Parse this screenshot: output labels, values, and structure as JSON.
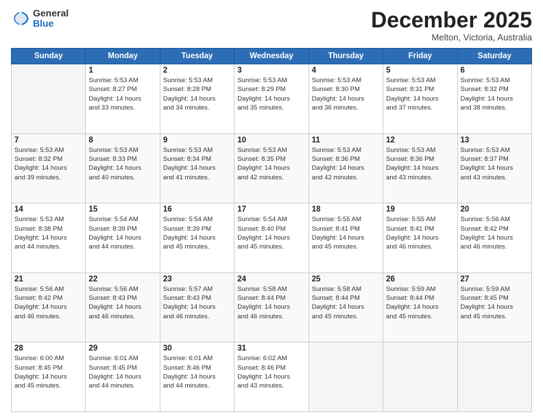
{
  "logo": {
    "general": "General",
    "blue": "Blue"
  },
  "header": {
    "month": "December 2025",
    "location": "Melton, Victoria, Australia"
  },
  "weekdays": [
    "Sunday",
    "Monday",
    "Tuesday",
    "Wednesday",
    "Thursday",
    "Friday",
    "Saturday"
  ],
  "days": [
    {
      "num": "",
      "info": ""
    },
    {
      "num": "1",
      "info": "Sunrise: 5:53 AM\nSunset: 8:27 PM\nDaylight: 14 hours\nand 33 minutes."
    },
    {
      "num": "2",
      "info": "Sunrise: 5:53 AM\nSunset: 8:28 PM\nDaylight: 14 hours\nand 34 minutes."
    },
    {
      "num": "3",
      "info": "Sunrise: 5:53 AM\nSunset: 8:29 PM\nDaylight: 14 hours\nand 35 minutes."
    },
    {
      "num": "4",
      "info": "Sunrise: 5:53 AM\nSunset: 8:30 PM\nDaylight: 14 hours\nand 36 minutes."
    },
    {
      "num": "5",
      "info": "Sunrise: 5:53 AM\nSunset: 8:31 PM\nDaylight: 14 hours\nand 37 minutes."
    },
    {
      "num": "6",
      "info": "Sunrise: 5:53 AM\nSunset: 8:32 PM\nDaylight: 14 hours\nand 38 minutes."
    },
    {
      "num": "7",
      "info": "Sunrise: 5:53 AM\nSunset: 8:32 PM\nDaylight: 14 hours\nand 39 minutes."
    },
    {
      "num": "8",
      "info": "Sunrise: 5:53 AM\nSunset: 8:33 PM\nDaylight: 14 hours\nand 40 minutes."
    },
    {
      "num": "9",
      "info": "Sunrise: 5:53 AM\nSunset: 8:34 PM\nDaylight: 14 hours\nand 41 minutes."
    },
    {
      "num": "10",
      "info": "Sunrise: 5:53 AM\nSunset: 8:35 PM\nDaylight: 14 hours\nand 42 minutes."
    },
    {
      "num": "11",
      "info": "Sunrise: 5:53 AM\nSunset: 8:36 PM\nDaylight: 14 hours\nand 42 minutes."
    },
    {
      "num": "12",
      "info": "Sunrise: 5:53 AM\nSunset: 8:36 PM\nDaylight: 14 hours\nand 43 minutes."
    },
    {
      "num": "13",
      "info": "Sunrise: 5:53 AM\nSunset: 8:37 PM\nDaylight: 14 hours\nand 43 minutes."
    },
    {
      "num": "14",
      "info": "Sunrise: 5:53 AM\nSunset: 8:38 PM\nDaylight: 14 hours\nand 44 minutes."
    },
    {
      "num": "15",
      "info": "Sunrise: 5:54 AM\nSunset: 8:39 PM\nDaylight: 14 hours\nand 44 minutes."
    },
    {
      "num": "16",
      "info": "Sunrise: 5:54 AM\nSunset: 8:39 PM\nDaylight: 14 hours\nand 45 minutes."
    },
    {
      "num": "17",
      "info": "Sunrise: 5:54 AM\nSunset: 8:40 PM\nDaylight: 14 hours\nand 45 minutes."
    },
    {
      "num": "18",
      "info": "Sunrise: 5:55 AM\nSunset: 8:41 PM\nDaylight: 14 hours\nand 45 minutes."
    },
    {
      "num": "19",
      "info": "Sunrise: 5:55 AM\nSunset: 8:41 PM\nDaylight: 14 hours\nand 46 minutes."
    },
    {
      "num": "20",
      "info": "Sunrise: 5:56 AM\nSunset: 8:42 PM\nDaylight: 14 hours\nand 46 minutes."
    },
    {
      "num": "21",
      "info": "Sunrise: 5:56 AM\nSunset: 8:42 PM\nDaylight: 14 hours\nand 46 minutes."
    },
    {
      "num": "22",
      "info": "Sunrise: 5:56 AM\nSunset: 8:43 PM\nDaylight: 14 hours\nand 46 minutes."
    },
    {
      "num": "23",
      "info": "Sunrise: 5:57 AM\nSunset: 8:43 PM\nDaylight: 14 hours\nand 46 minutes."
    },
    {
      "num": "24",
      "info": "Sunrise: 5:58 AM\nSunset: 8:44 PM\nDaylight: 14 hours\nand 46 minutes."
    },
    {
      "num": "25",
      "info": "Sunrise: 5:58 AM\nSunset: 8:44 PM\nDaylight: 14 hours\nand 45 minutes."
    },
    {
      "num": "26",
      "info": "Sunrise: 5:59 AM\nSunset: 8:44 PM\nDaylight: 14 hours\nand 45 minutes."
    },
    {
      "num": "27",
      "info": "Sunrise: 5:59 AM\nSunset: 8:45 PM\nDaylight: 14 hours\nand 45 minutes."
    },
    {
      "num": "28",
      "info": "Sunrise: 6:00 AM\nSunset: 8:45 PM\nDaylight: 14 hours\nand 45 minutes."
    },
    {
      "num": "29",
      "info": "Sunrise: 6:01 AM\nSunset: 8:45 PM\nDaylight: 14 hours\nand 44 minutes."
    },
    {
      "num": "30",
      "info": "Sunrise: 6:01 AM\nSunset: 8:46 PM\nDaylight: 14 hours\nand 44 minutes."
    },
    {
      "num": "31",
      "info": "Sunrise: 6:02 AM\nSunset: 8:46 PM\nDaylight: 14 hours\nand 43 minutes."
    },
    {
      "num": "",
      "info": ""
    },
    {
      "num": "",
      "info": ""
    },
    {
      "num": "",
      "info": ""
    }
  ]
}
